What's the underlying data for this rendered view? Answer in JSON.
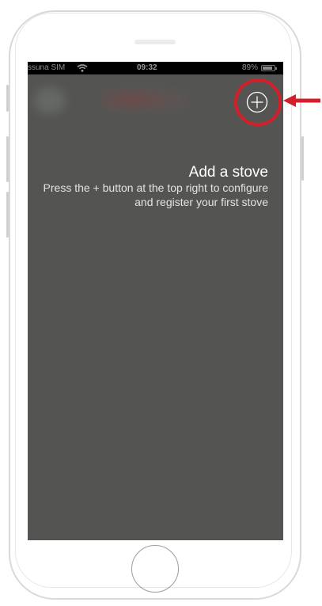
{
  "status_bar": {
    "carrier": "ssuna SIM",
    "time": "09:32",
    "battery_percent": "89%",
    "battery_level": 0.89,
    "wifi_icon": "wifi-icon"
  },
  "header": {
    "add_button_icon": "plus-circle-icon"
  },
  "empty_state": {
    "title": "Add a stove",
    "message": "Press the + button at the top right to configure and register your first stove"
  },
  "annotation": {
    "highlight_color": "#d41f2a",
    "arrow_icon": "arrow-left-icon"
  },
  "colors": {
    "screen_background": "#545553",
    "status_bar_background": "#000000",
    "title_text": "#ffffff",
    "body_text": "#e3e3e3"
  }
}
